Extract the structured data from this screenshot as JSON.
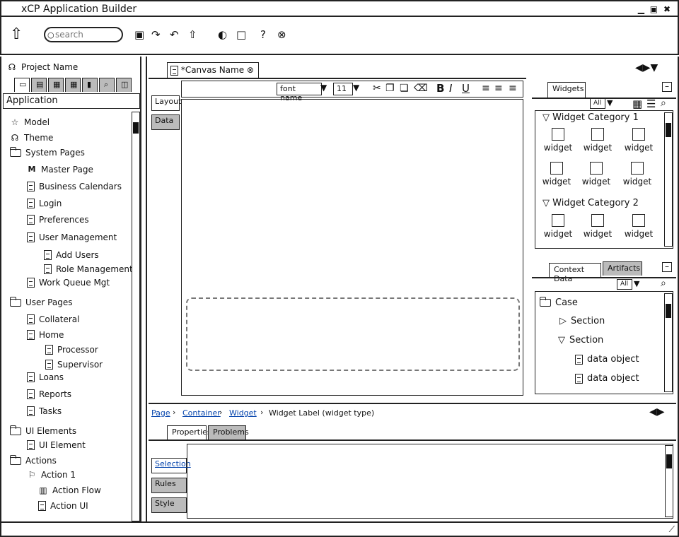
{
  "window": {
    "title": "xCP Application Builder",
    "controls": "▁ ▣ ✖"
  },
  "toolbar": {
    "search_placeholder": "search"
  },
  "project": {
    "name": "Project Name"
  },
  "app_panel": {
    "title": "Application"
  },
  "tree": {
    "model": "Model",
    "theme": "Theme",
    "system_pages": "System Pages",
    "master_page": "Master Page",
    "business_calendars": "Business Calendars",
    "login": "Login",
    "preferences": "Preferences",
    "user_management": "User Management",
    "add_users": "Add Users",
    "role_management": "Role Management",
    "work_queue_mgt": "Work Queue Mgt",
    "user_pages": "User Pages",
    "collateral": "Collateral",
    "home": "Home",
    "processor": "Processor",
    "supervisor": "Supervisor",
    "loans": "Loans",
    "reports": "Reports",
    "tasks": "Tasks",
    "ui_elements": "UI Elements",
    "ui_element": "UI Element",
    "actions": "Actions",
    "action1": "Action 1",
    "action_flow": "Action Flow",
    "action_ui": "Action UI"
  },
  "editor": {
    "tab_label": "*Canvas Name",
    "font_name": "font name",
    "font_size": "11",
    "side_tabs": {
      "layout": "Layout",
      "data": "Data"
    }
  },
  "breadcrumb": {
    "page": "Page",
    "container": "Container",
    "widget": "Widget",
    "label": "Widget Label (widget type)"
  },
  "bottom": {
    "tabs": {
      "properties": "Properties",
      "problems": "Problems"
    },
    "side_tabs": {
      "selection": "Selection",
      "rules": "Rules",
      "style": "Style"
    }
  },
  "widgets_panel": {
    "tab": "Widgets",
    "filter": "All",
    "cat1": "Widget Category 1",
    "cat2": "Widget Category 2",
    "widget_label": "widget"
  },
  "context_panel": {
    "tab_context": "Context Data",
    "tab_artifacts": "Artifacts",
    "filter": "All",
    "case": "Case",
    "section1": "Section",
    "section2": "Section",
    "data_object1": "data object",
    "data_object2": "data object"
  },
  "colors": {
    "link": "#0645ad",
    "tab_inactive": "#bbbbbb",
    "line": "#222222"
  }
}
